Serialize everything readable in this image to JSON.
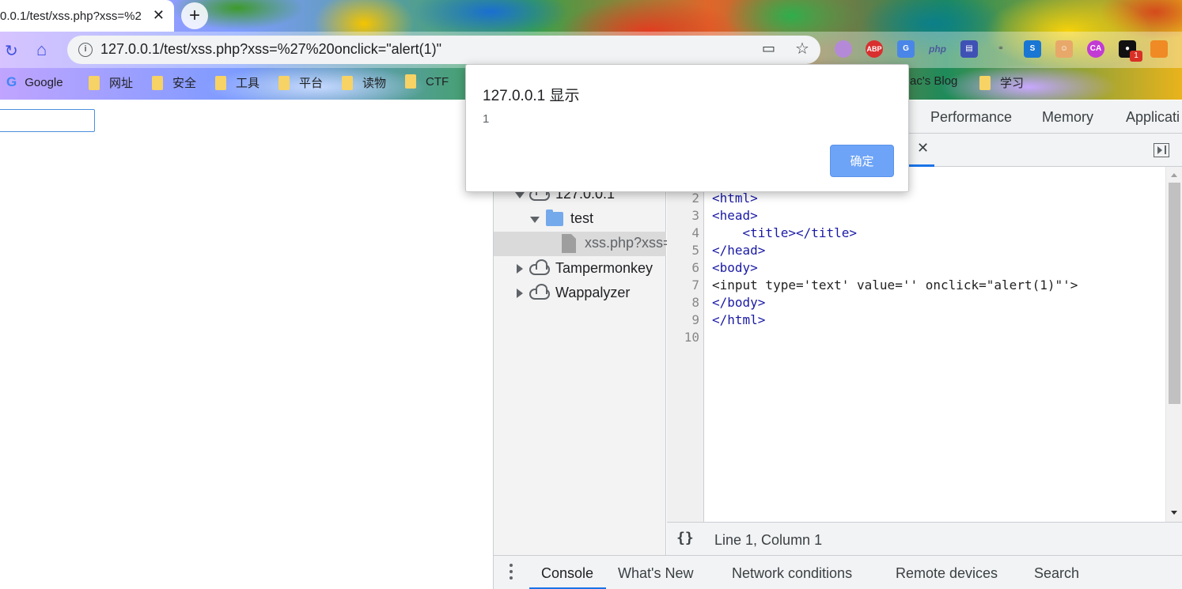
{
  "browser": {
    "tab_title": "0.0.1/test/xss.php?xss=%2",
    "url": "127.0.0.1/test/xss.php?xss=%27%20onclick=\"alert(1)\"",
    "extension_badge": "1",
    "bookmarks": [
      {
        "label": "Google",
        "type": "site"
      },
      {
        "label": "网址",
        "type": "folder"
      },
      {
        "label": "安全",
        "type": "folder"
      },
      {
        "label": "工具",
        "type": "folder"
      },
      {
        "label": "平台",
        "type": "folder"
      },
      {
        "label": "读物",
        "type": "folder"
      },
      {
        "label": "CTF",
        "type": "folder"
      },
      {
        "label": "ac's Blog",
        "type": "site"
      },
      {
        "label": "学习",
        "type": "folder"
      }
    ]
  },
  "devtools": {
    "tabs": [
      "Performance",
      "Memory",
      "Applicati"
    ],
    "tree": {
      "host": "127.0.0.1",
      "folder": "test",
      "file": "xss.php?xss=",
      "others": [
        "Tampermonkey",
        "Wappalyzer"
      ]
    },
    "code": {
      "line_numbers": [
        "2",
        "3",
        "4",
        "5",
        "6",
        "7",
        "8",
        "9",
        "10"
      ],
      "lines": [
        "<html>",
        "<head>",
        "    <title></title>",
        "</head>",
        "<body>",
        "<input type='text' value='' onclick=\"alert(1)\"'>",
        "</body>",
        "</html>",
        ""
      ]
    },
    "status": {
      "pretty_print": "{}",
      "cursor": "Line 1, Column 1"
    },
    "drawer_tabs": [
      "Console",
      "What's New",
      "Network conditions",
      "Remote devices",
      "Search"
    ]
  },
  "dialog": {
    "title": "127.0.0.1 显示",
    "message": "1",
    "ok_label": "确定"
  },
  "colors": {
    "accent": "#1a73e8",
    "dialog_button": "#6ea4f7"
  }
}
